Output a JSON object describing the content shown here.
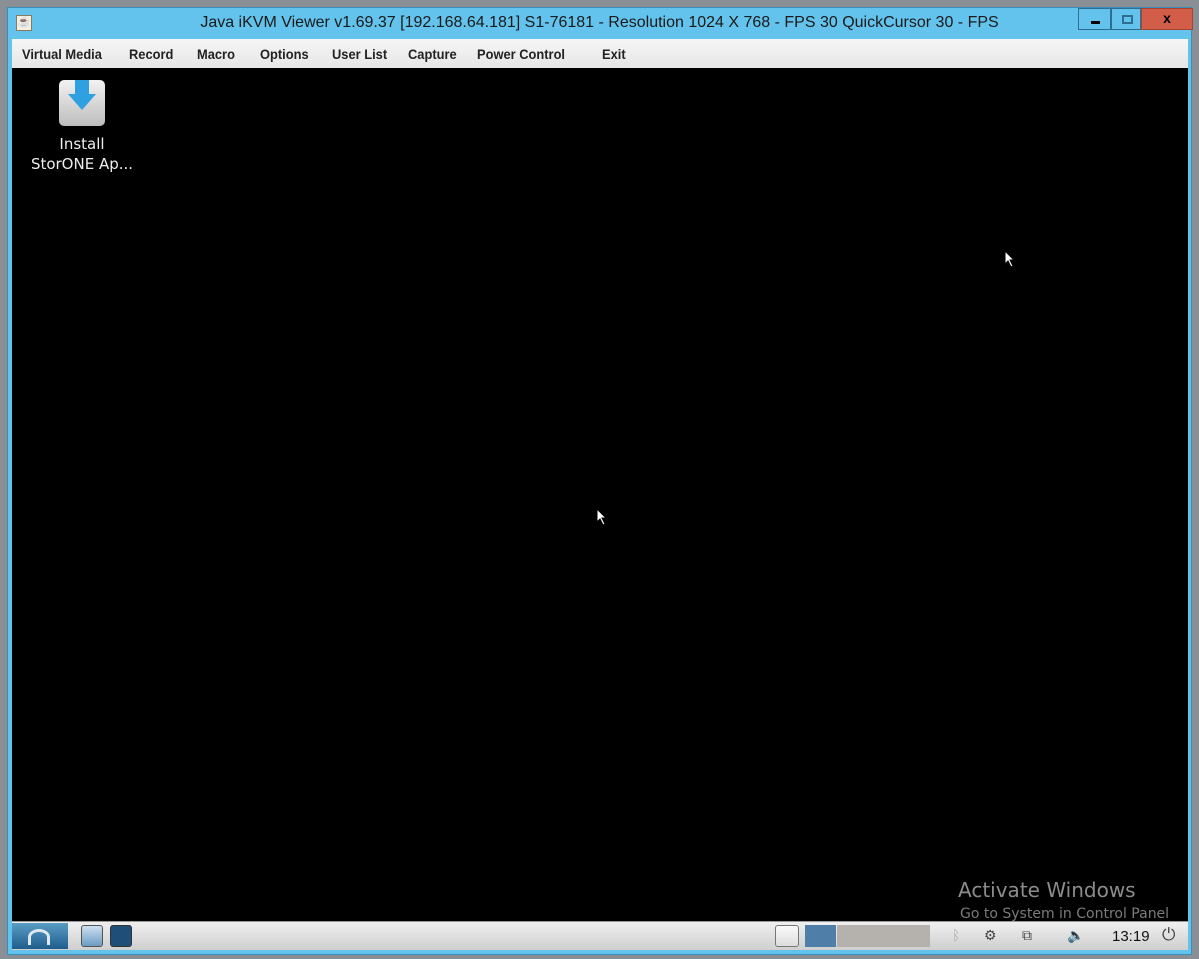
{
  "window": {
    "title": "Java iKVM Viewer v1.69.37 [192.168.64.181] S1-76181 - Resolution 1024 X 768 - FPS 30 QuickCursor 30 - FPS",
    "controls": {
      "minimize": "minimize",
      "maximize": "maximize",
      "close": "x"
    }
  },
  "menu": [
    "Virtual Media",
    "Record",
    "Macro",
    "Options",
    "User List",
    "Capture",
    "Power Control",
    "Exit"
  ],
  "desktop": {
    "icons": [
      {
        "label_line1": "Install",
        "label_line2": "StorONE Ap...",
        "icon": "install-drive-icon"
      }
    ]
  },
  "watermark": {
    "title": "Activate Windows",
    "subtitle": "Go to System in Control Panel"
  },
  "taskbar": {
    "clock": "13:19",
    "workspaces": 4,
    "active_workspace": 1,
    "tray_icons": [
      "bluetooth-icon",
      "update-notifier-icon",
      "network-disconnected-icon",
      "volume-icon",
      "power-icon"
    ]
  },
  "colors": {
    "titlebar": "#63c3ec",
    "close": "#d25d49",
    "start": "#1f5d8c",
    "active_workspace": "#4f7ea8"
  }
}
